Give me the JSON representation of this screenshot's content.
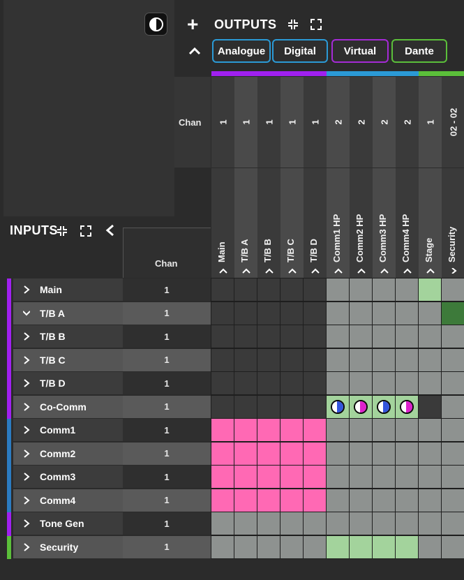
{
  "outputs": {
    "title": "OUTPUTS",
    "tabs": [
      {
        "label": "Analogue",
        "border": "#2b9ad6"
      },
      {
        "label": "Digital",
        "border": "#2b9ad6"
      },
      {
        "label": "Virtual",
        "border": "#a52ad6"
      },
      {
        "label": "Dante",
        "border": "#5bbf3a"
      }
    ],
    "chan_label": "Chan",
    "columns": [
      {
        "chan": "1",
        "name": "Main",
        "band": "#a020f0",
        "top_bg": "#3a3a3a"
      },
      {
        "chan": "1",
        "name": "T/B A",
        "band": "#a020f0",
        "top_bg": "#4a4a4a"
      },
      {
        "chan": "1",
        "name": "T/B B",
        "band": "#a020f0",
        "top_bg": "#3a3a3a"
      },
      {
        "chan": "1",
        "name": "T/B C",
        "band": "#a020f0",
        "top_bg": "#4a4a4a"
      },
      {
        "chan": "1",
        "name": "T/B D",
        "band": "#a020f0",
        "top_bg": "#3a3a3a"
      },
      {
        "chan": "2",
        "name": "Comm1 HP",
        "band": "#2b9ad6",
        "top_bg": "#4a4a4a"
      },
      {
        "chan": "2",
        "name": "Comm2 HP",
        "band": "#2b9ad6",
        "top_bg": "#3a3a3a"
      },
      {
        "chan": "2",
        "name": "Comm3 HP",
        "band": "#2b9ad6",
        "top_bg": "#4a4a4a"
      },
      {
        "chan": "2",
        "name": "Comm4 HP",
        "band": "#2b9ad6",
        "top_bg": "#3a3a3a"
      },
      {
        "chan": "1",
        "name": "Stage",
        "band": "#5bbf3a",
        "top_bg": "#4a4a4a"
      },
      {
        "chan": "02 - 02",
        "name": "Security",
        "band": "#5bbf3a",
        "top_bg": "#3a3a3a"
      }
    ]
  },
  "inputs": {
    "title": "INPUTS",
    "chan_label": "Chan",
    "rows": [
      {
        "name": "Main",
        "chan": "1",
        "bar": "#a020f0",
        "expanded": false
      },
      {
        "name": "T/B A",
        "chan": "1",
        "bar": "#a020f0",
        "expanded": true
      },
      {
        "name": "T/B B",
        "chan": "1",
        "bar": "#a020f0",
        "expanded": false
      },
      {
        "name": "T/B C",
        "chan": "1",
        "bar": "#a020f0",
        "expanded": false
      },
      {
        "name": "T/B D",
        "chan": "1",
        "bar": "#a020f0",
        "expanded": false
      },
      {
        "name": "Co-Comm",
        "chan": "1",
        "bar": "#a020f0",
        "expanded": false
      },
      {
        "name": "Comm1",
        "chan": "1",
        "bar": "#2b7bc0",
        "expanded": false
      },
      {
        "name": "Comm2",
        "chan": "1",
        "bar": "#2b7bc0",
        "expanded": false
      },
      {
        "name": "Comm3",
        "chan": "1",
        "bar": "#2b7bc0",
        "expanded": false
      },
      {
        "name": "Comm4",
        "chan": "1",
        "bar": "#2b7bc0",
        "expanded": false
      },
      {
        "name": "Tone Gen",
        "chan": "1",
        "bar": "#a020f0",
        "expanded": false
      },
      {
        "name": "Security",
        "chan": "1",
        "bar": "#5bbf3a",
        "expanded": false
      }
    ]
  },
  "colors": {
    "dark_cell": "#3a3a3a",
    "grey_cell": "#8e9290",
    "routed_pink": "#ff69b4",
    "light_green": "#a3d39c",
    "dark_green": "#3d7a3a",
    "indicator_blue": "#3355dd",
    "indicator_magenta": "#dd22cc"
  },
  "matrix": [
    [
      "d",
      "d",
      "d",
      "d",
      "d",
      "g",
      "g",
      "g",
      "g",
      "lg",
      "g"
    ],
    [
      "d",
      "d",
      "d",
      "d",
      "d",
      "g",
      "g",
      "g",
      "g",
      "g",
      "dg"
    ],
    [
      "d",
      "d",
      "d",
      "d",
      "d",
      "g",
      "g",
      "g",
      "g",
      "g",
      "g"
    ],
    [
      "d",
      "d",
      "d",
      "d",
      "d",
      "g",
      "g",
      "g",
      "g",
      "g",
      "g"
    ],
    [
      "d",
      "d",
      "d",
      "d",
      "d",
      "g",
      "g",
      "g",
      "g",
      "g",
      "g"
    ],
    [
      "d",
      "d",
      "d",
      "d",
      "d",
      "ib",
      "im",
      "ib",
      "im",
      "d",
      "g"
    ],
    [
      "p",
      "p",
      "p",
      "p",
      "p",
      "g",
      "g",
      "g",
      "g",
      "g",
      "g"
    ],
    [
      "p",
      "p",
      "p",
      "p",
      "p",
      "g",
      "g",
      "g",
      "g",
      "g",
      "g"
    ],
    [
      "p",
      "p",
      "p",
      "p",
      "p",
      "g",
      "g",
      "g",
      "g",
      "g",
      "g"
    ],
    [
      "p",
      "p",
      "p",
      "p",
      "p",
      "g",
      "g",
      "g",
      "g",
      "g",
      "g"
    ],
    [
      "g",
      "g",
      "g",
      "g",
      "g",
      "g",
      "g",
      "g",
      "g",
      "g",
      "g"
    ],
    [
      "g",
      "g",
      "g",
      "g",
      "g",
      "lg",
      "lg",
      "lg",
      "lg",
      "g",
      "g"
    ]
  ]
}
